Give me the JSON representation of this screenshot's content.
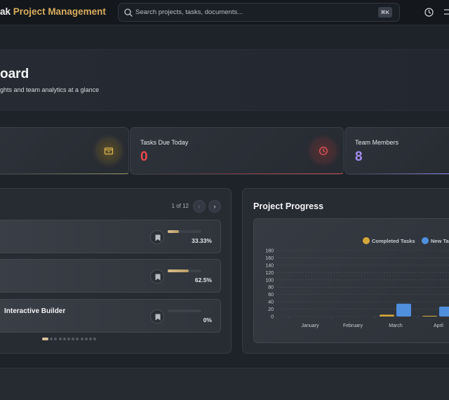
{
  "topbar": {
    "brand_prefix": "ak",
    "brand_name": "Project Management",
    "search_placeholder": "Search projects, tasks, documents...",
    "search_shortcut": "⌘K",
    "icons": [
      "search-icon",
      "clock-icon",
      "settings-icon"
    ]
  },
  "hero": {
    "title": "oard",
    "subtitle": "ghts and team analytics at a glance"
  },
  "stats": [
    {
      "label": "Tasks Due Today",
      "value": "0",
      "value_color": "#e8484d",
      "icon": "clock-icon",
      "accent": "#c4474c"
    },
    {
      "label": "Team Members",
      "value": "8",
      "value_color": "#a58bf0",
      "icon": "",
      "accent": "#8a8ff0"
    }
  ],
  "stat_partial": {
    "icon": "folder-icon",
    "accent": "#8c8a5a"
  },
  "tasks": {
    "pager": "1 of 12",
    "prev_label": "‹",
    "next_label": "›",
    "items": [
      {
        "name": "",
        "progress": 33.33,
        "percent_label": "33.33%"
      },
      {
        "name": "",
        "progress": 62.5,
        "percent_label": "62.5%"
      },
      {
        "name": "Interactive Builder",
        "progress": 0,
        "percent_label": "0%"
      }
    ],
    "page_dots": 12,
    "active_dot": 0
  },
  "progress": {
    "title": "Project Progress"
  },
  "chart_data": {
    "type": "bar",
    "categories": [
      "January",
      "February",
      "March",
      "April"
    ],
    "series": [
      {
        "name": "Completed Tasks",
        "color": "#d4a838",
        "values": [
          0,
          0,
          5,
          1
        ]
      },
      {
        "name": "New Tasks",
        "color": "#4f8fdd",
        "values": [
          0,
          0,
          35,
          27
        ]
      }
    ],
    "yticks": [
      "0",
      "20",
      "40",
      "60",
      "80",
      "100",
      "120",
      "140",
      "160",
      "180"
    ],
    "ylim": [
      0,
      180
    ],
    "grid": true,
    "legend": "top-right"
  }
}
